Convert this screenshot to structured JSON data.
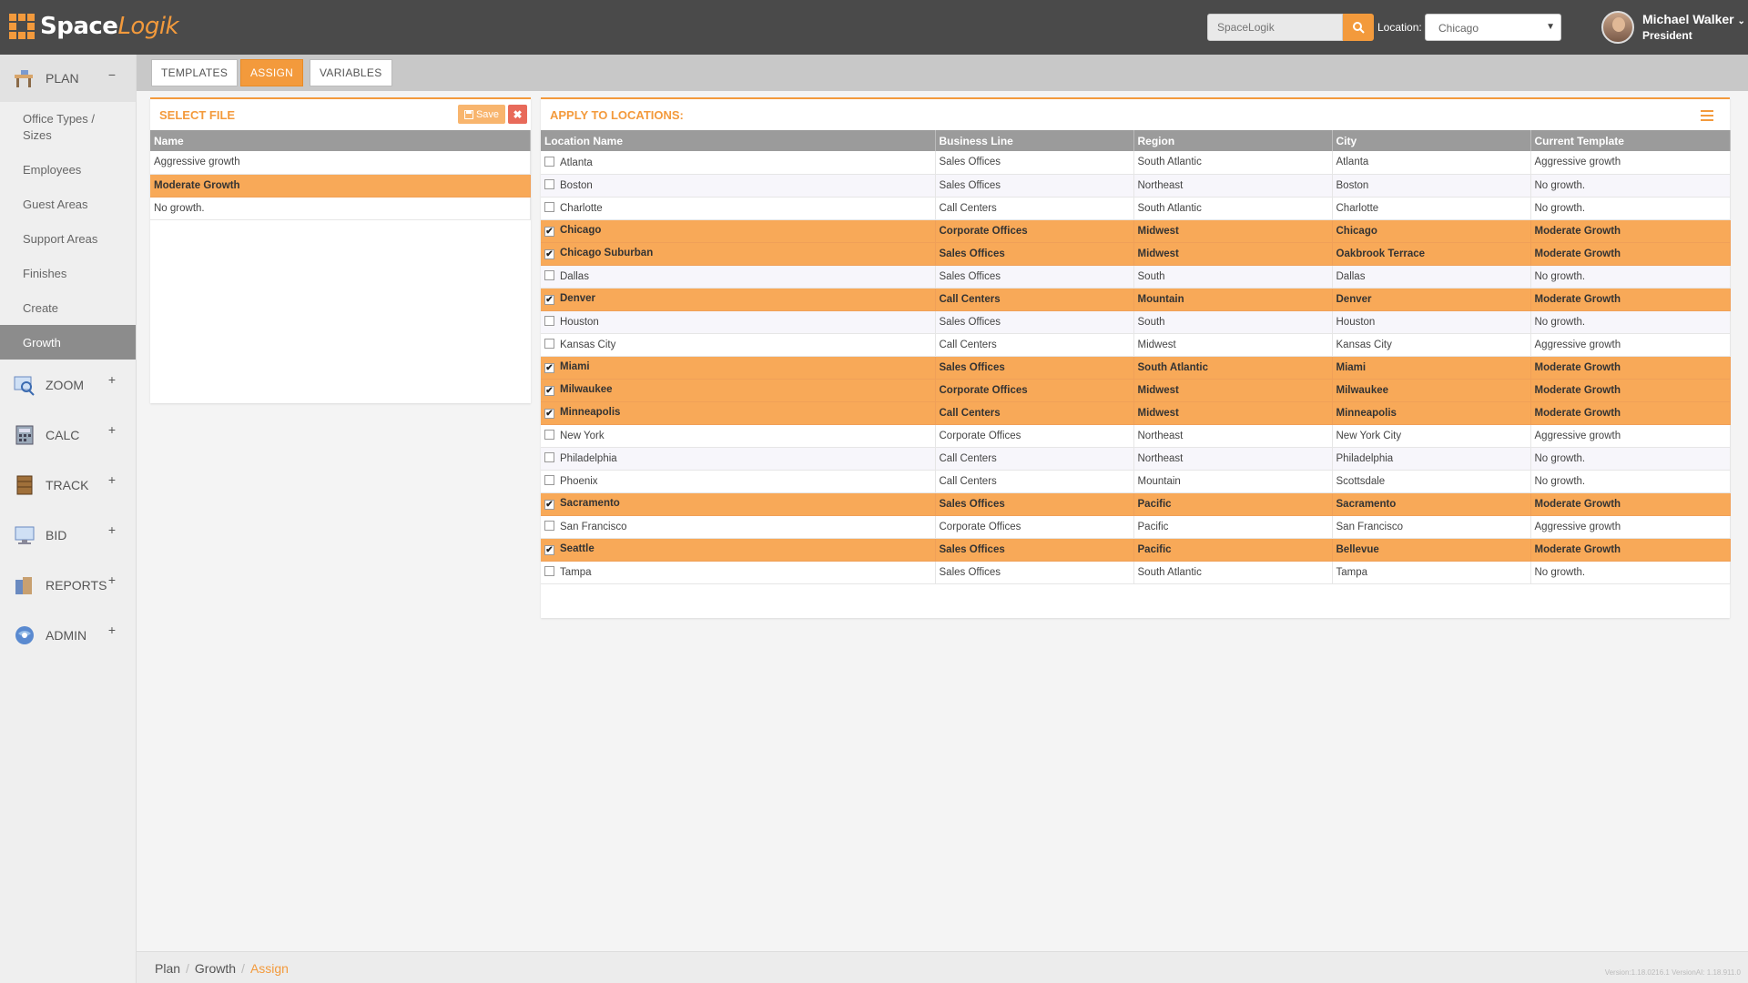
{
  "app": {
    "brand_part1": "Space",
    "brand_part2": "Logik"
  },
  "header": {
    "search_placeholder": "SpaceLogik",
    "location_label": "Location:",
    "location_value": "Chicago",
    "user_name": "Michael Walker",
    "user_role": "President"
  },
  "sidebar": {
    "plan": {
      "label": "PLAN",
      "toggle": "−"
    },
    "subitems": [
      "Office Types / Sizes",
      "Employees",
      "Guest Areas",
      "Support Areas",
      "Finishes",
      "Create",
      "Growth"
    ],
    "sections": [
      {
        "label": "ZOOM",
        "toggle": "+"
      },
      {
        "label": "CALC",
        "toggle": "+"
      },
      {
        "label": "TRACK",
        "toggle": "+"
      },
      {
        "label": "BID",
        "toggle": "+"
      },
      {
        "label": "REPORTS",
        "toggle": "+"
      },
      {
        "label": "ADMIN",
        "toggle": "+"
      }
    ]
  },
  "tabs": [
    "TEMPLATES",
    "ASSIGN",
    "VARIABLES"
  ],
  "select_file": {
    "title": "SELECT FILE",
    "save_label": "Save",
    "header": "Name",
    "rows": [
      "Aggressive growth",
      "Moderate Growth",
      "No growth."
    ]
  },
  "apply": {
    "title": "APPLY TO LOCATIONS:",
    "headers": [
      "Location Name",
      "Business Line",
      "Region",
      "City",
      "Current Template"
    ],
    "rows": [
      {
        "checked": false,
        "cells": [
          "Atlanta",
          "Sales Offices",
          "South Atlantic",
          "Atlanta",
          "Aggressive growth"
        ]
      },
      {
        "checked": false,
        "cells": [
          "Boston",
          "Sales Offices",
          "Northeast",
          "Boston",
          "No growth."
        ]
      },
      {
        "checked": false,
        "cells": [
          "Charlotte",
          "Call Centers",
          "South Atlantic",
          "Charlotte",
          "No growth."
        ]
      },
      {
        "checked": true,
        "cells": [
          "Chicago",
          "Corporate Offices",
          "Midwest",
          "Chicago",
          "Moderate Growth"
        ]
      },
      {
        "checked": true,
        "cells": [
          "Chicago Suburban",
          "Sales Offices",
          "Midwest",
          "Oakbrook Terrace",
          "Moderate Growth"
        ]
      },
      {
        "checked": false,
        "cells": [
          "Dallas",
          "Sales Offices",
          "South",
          "Dallas",
          "No growth."
        ]
      },
      {
        "checked": true,
        "cells": [
          "Denver",
          "Call Centers",
          "Mountain",
          "Denver",
          "Moderate Growth"
        ]
      },
      {
        "checked": false,
        "cells": [
          "Houston",
          "Sales Offices",
          "South",
          "Houston",
          "No growth."
        ]
      },
      {
        "checked": false,
        "cells": [
          "Kansas City",
          "Call Centers",
          "Midwest",
          "Kansas City",
          "Aggressive growth"
        ]
      },
      {
        "checked": true,
        "cells": [
          "Miami",
          "Sales Offices",
          "South Atlantic",
          "Miami",
          "Moderate Growth"
        ]
      },
      {
        "checked": true,
        "cells": [
          "Milwaukee",
          "Corporate Offices",
          "Midwest",
          "Milwaukee",
          "Moderate Growth"
        ]
      },
      {
        "checked": true,
        "cells": [
          "Minneapolis",
          "Call Centers",
          "Midwest",
          "Minneapolis",
          "Moderate Growth"
        ]
      },
      {
        "checked": false,
        "cells": [
          "New York",
          "Corporate Offices",
          "Northeast",
          "New York City",
          "Aggressive growth"
        ]
      },
      {
        "checked": false,
        "cells": [
          "Philadelphia",
          "Call Centers",
          "Northeast",
          "Philadelphia",
          "No growth."
        ]
      },
      {
        "checked": false,
        "cells": [
          "Phoenix",
          "Call Centers",
          "Mountain",
          "Scottsdale",
          "No growth."
        ]
      },
      {
        "checked": true,
        "cells": [
          "Sacramento",
          "Sales Offices",
          "Pacific",
          "Sacramento",
          "Moderate Growth"
        ]
      },
      {
        "checked": false,
        "cells": [
          "San Francisco",
          "Corporate Offices",
          "Pacific",
          "San Francisco",
          "Aggressive growth"
        ]
      },
      {
        "checked": true,
        "cells": [
          "Seattle",
          "Sales Offices",
          "Pacific",
          "Bellevue",
          "Moderate Growth"
        ]
      },
      {
        "checked": false,
        "cells": [
          "Tampa",
          "Sales Offices",
          "South Atlantic",
          "Tampa",
          "No growth."
        ]
      }
    ]
  },
  "breadcrumb": [
    "Plan",
    "Growth",
    "Assign"
  ],
  "version": "Version:1.18.0216.1 VersionAI: 1.18.911.0",
  "colors": {
    "accent": "#f39a3c",
    "selected_row": "#f8a958",
    "topbar": "#4a4a4a"
  }
}
